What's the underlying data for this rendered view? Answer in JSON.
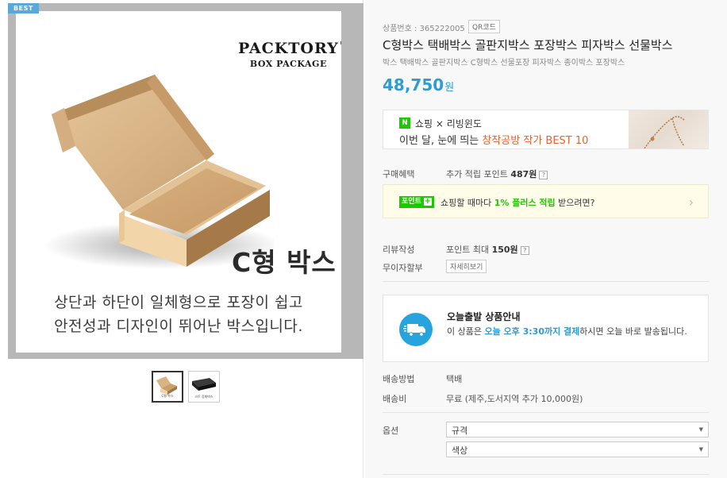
{
  "badge": "BEST",
  "image": {
    "brand_title": "PACKTORY",
    "brand_sub": "BOX PACKAGE",
    "box_label": "C형 박스",
    "desc_line1": "상단과 하단이 일체형으로 포장이 쉽고",
    "desc_line2": "안전성과 디자인이 뛰어난 박스입니다."
  },
  "thumbnails": [
    {
      "label": "C형 박스",
      "active": true
    },
    {
      "label": "스트 강화박스",
      "active": false
    }
  ],
  "product": {
    "number_label": "상품번호 : 365222005",
    "qr_label": "QR코드",
    "title": "C형박스 택배박스 골판지박스 포장박스 피자박스 선물박스",
    "subtitle": "박스 택배박스 골판지박스 C형박스 선물포장 피자박스 종이박스 포장박스",
    "price": "48,750",
    "price_unit": "원"
  },
  "banner": {
    "badge": "N",
    "line1": "쇼핑 × 리빙윈도",
    "line2_prefix": "이번 달, 눈에 띄는 ",
    "line2_highlight": "창작공방 작가 BEST 10"
  },
  "benefit": {
    "label": "구매혜택",
    "value_prefix": "추가 적립 포인트 ",
    "value_bold": "487원",
    "help": "?"
  },
  "point": {
    "badge": "포인트",
    "plus": "+",
    "text_prefix": "쇼핑할 때마다 ",
    "text_green": "1% 플러스 적립",
    "text_suffix": " 받으려면?",
    "chevron": "›"
  },
  "review": {
    "label": "리뷰작성",
    "value_prefix": "포인트 최대 ",
    "value_bold": "150원",
    "help": "?"
  },
  "installment": {
    "label": "무이자할부",
    "button": "자세히보기"
  },
  "shipping_notice": {
    "title": "오늘출발 상품안내",
    "desc_prefix": "이 상품은 ",
    "desc_blue": "오늘 오후 3:30까지 결제",
    "desc_suffix": "하시면 오늘 바로 발송됩니다."
  },
  "delivery": {
    "method_label": "배송방법",
    "method_value": "택배",
    "fee_label": "배송비",
    "fee_value": "무료 (제주,도서지역 추가 10,000원)"
  },
  "options": {
    "label": "옵션",
    "select1": "규격",
    "select2": "색상"
  },
  "colors": {
    "price": "#2c9cd4",
    "naver_green": "#1ec800",
    "highlight_orange": "#e9622c",
    "best_badge": "#5aa8d7"
  }
}
